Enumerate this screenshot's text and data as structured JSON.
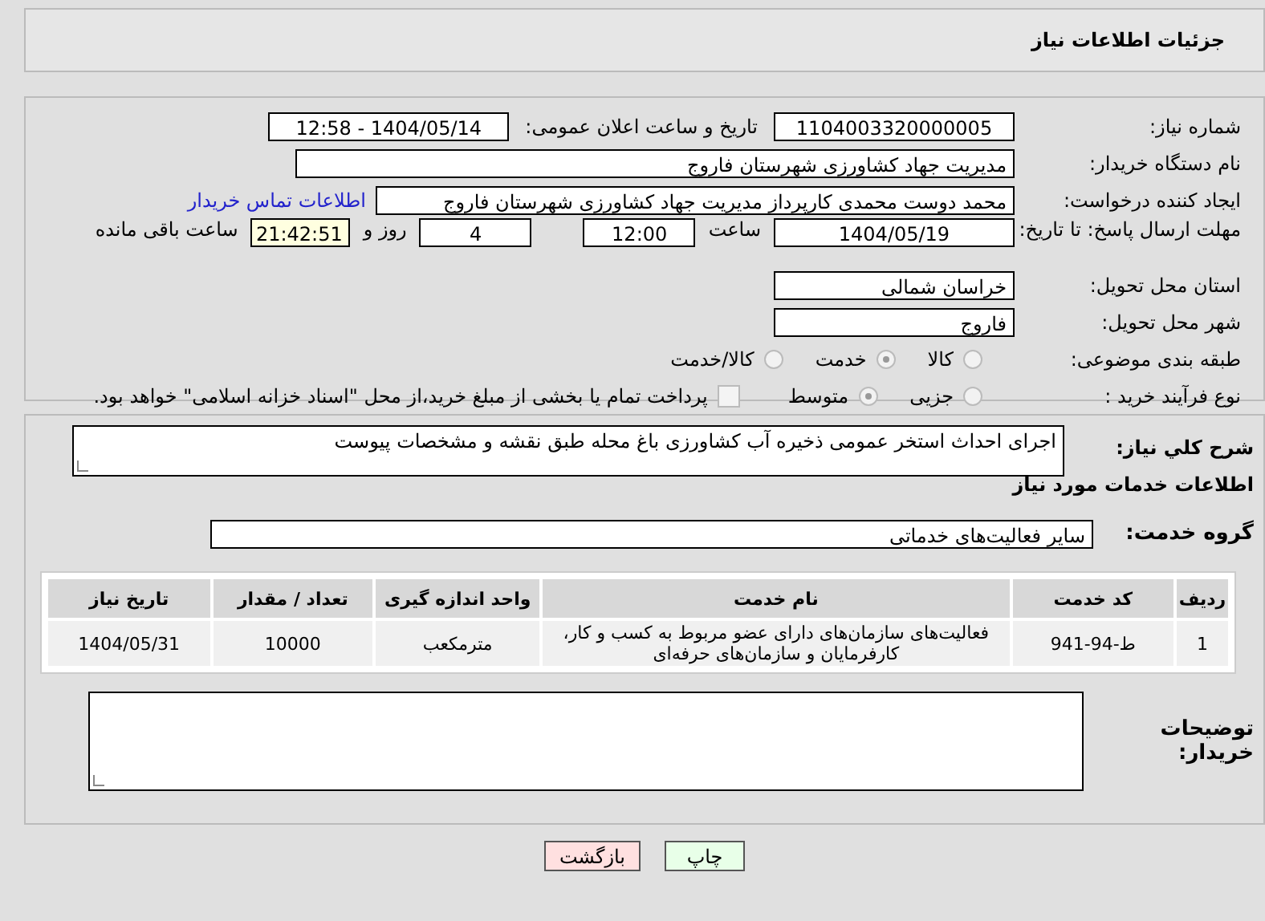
{
  "header": {
    "title": "جزئیات اطلاعات نیاز"
  },
  "need_number": {
    "label": "شماره نیاز:",
    "value": "1104003320000005"
  },
  "announce": {
    "label": "تاریخ و ساعت اعلان عمومی:",
    "value": "1404/05/14 - 12:58"
  },
  "buyer": {
    "label": "نام دستگاه خریدار:",
    "value": "مدیریت جهاد کشاورزی شهرستان فاروج"
  },
  "requester": {
    "label": "ایجاد کننده درخواست:",
    "value": "محمد  دوست محمدی کارپرداز مدیریت جهاد کشاورزی شهرستان فاروج",
    "link": "اطلاعات تماس خریدار"
  },
  "deadline": {
    "label": "مهلت ارسال پاسخ: تا تاریخ:",
    "date": "1404/05/19",
    "time_label": "ساعت",
    "time": "12:00",
    "days": "4",
    "days_label": "روز و",
    "remaining": "21:42:51",
    "remaining_label": "ساعت باقی مانده"
  },
  "province": {
    "label": "استان محل تحویل:",
    "value": "خراسان شمالی"
  },
  "city": {
    "label": "شهر محل تحویل:",
    "value": "فاروج"
  },
  "category": {
    "label": "طبقه بندی موضوعی:",
    "options": [
      {
        "label": "کالا",
        "selected": false
      },
      {
        "label": "خدمت",
        "selected": true
      },
      {
        "label": "کالا/خدمت",
        "selected": false
      }
    ]
  },
  "process": {
    "label": "نوع فرآیند خرید :",
    "options": [
      {
        "label": "جزیی",
        "selected": false
      },
      {
        "label": "متوسط",
        "selected": true
      }
    ],
    "payment": {
      "label": "پرداخت تمام یا بخشی از مبلغ خرید،از محل \"اسناد خزانه اسلامی\" خواهد بود.",
      "checked": false
    }
  },
  "description": {
    "label": "شرح كلي نياز:",
    "value": "اجرای احداث استخر عمومی ذخیره آب کشاورزی باغ محله طبق نقشه و مشخصات پیوست"
  },
  "services_title": "اطلاعات خدمات مورد نیاز",
  "service_group": {
    "label": "گروه خدمت:",
    "value": "سایر فعالیت‌های خدماتی"
  },
  "table": {
    "columns": [
      "ردیف",
      "کد خدمت",
      "نام خدمت",
      "واحد اندازه گیری",
      "تعداد / مقدار",
      "تاریخ نیاز"
    ],
    "rows": [
      [
        "1",
        "ط-94-941",
        "فعالیت‌های سازمان‌های دارای عضو مربوط به کسب و کار، کارفرمایان و سازمان‌های حرفه‌ای",
        "مترمکعب",
        "10000",
        "1404/05/31"
      ]
    ]
  },
  "buyer_notes": {
    "label": "توضیحات خریدار:"
  },
  "buttons": [
    {
      "label": "چاپ",
      "kind": "print"
    },
    {
      "label": "بازگشت",
      "kind": "back"
    }
  ]
}
